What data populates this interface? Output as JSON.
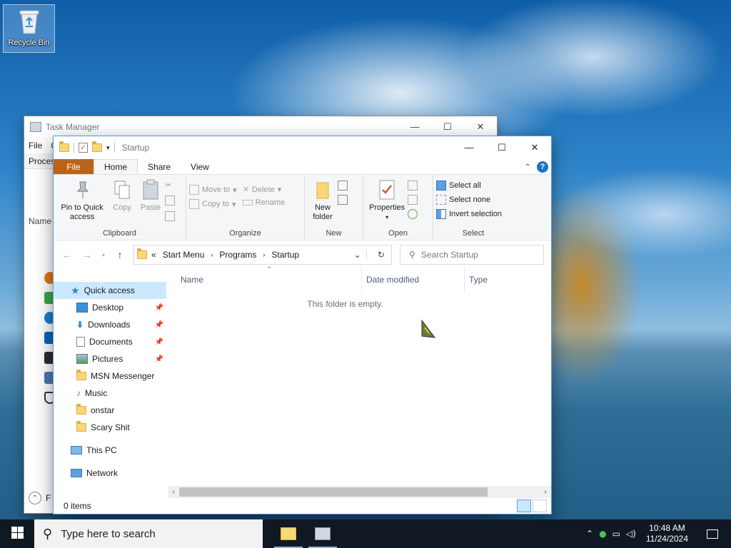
{
  "desktop": {
    "recycle_bin_label": "Recycle Bin"
  },
  "task_manager": {
    "title": "Task Manager",
    "menu_file": "File",
    "menu_partial": "O",
    "tab_processes": "Proces",
    "col_name": "Name",
    "footer_label": "F",
    "controls": {
      "minimize": "—",
      "maximize": "☐",
      "close": "✕"
    }
  },
  "explorer": {
    "title": "Startup",
    "controls": {
      "minimize": "—",
      "maximize": "☐",
      "close": "✕"
    },
    "ribbon_tabs": {
      "file": "File",
      "home": "Home",
      "share": "Share",
      "view": "View"
    },
    "clipboard": {
      "pin": "Pin to Quick access",
      "copy": "Copy",
      "paste": "Paste",
      "group": "Clipboard"
    },
    "organize": {
      "move_to": "Move to",
      "copy_to": "Copy to",
      "delete": "Delete",
      "rename": "Rename",
      "group": "Organize"
    },
    "new": {
      "new_folder": "New folder",
      "group": "New"
    },
    "open": {
      "properties": "Properties",
      "group": "Open"
    },
    "select": {
      "select_all": "Select all",
      "select_none": "Select none",
      "invert": "Invert selection",
      "group": "Select"
    },
    "address": {
      "prefix": "«",
      "crumbs": [
        "Start Menu",
        "Programs",
        "Startup"
      ],
      "search_placeholder": "Search Startup"
    },
    "nav": {
      "quick_access": "Quick access",
      "items": [
        "Desktop",
        "Downloads",
        "Documents",
        "Pictures",
        "MSN Messenger",
        "Music",
        "onstar",
        "Scary Shit"
      ],
      "this_pc": "This PC",
      "network": "Network"
    },
    "columns": {
      "name": "Name",
      "date_modified": "Date modified",
      "type": "Type"
    },
    "empty_message": "This folder is empty.",
    "status_items": "0 items"
  },
  "taskbar": {
    "search_placeholder": "Type here to search",
    "time": "10:48 AM",
    "date": "11/24/2024"
  }
}
